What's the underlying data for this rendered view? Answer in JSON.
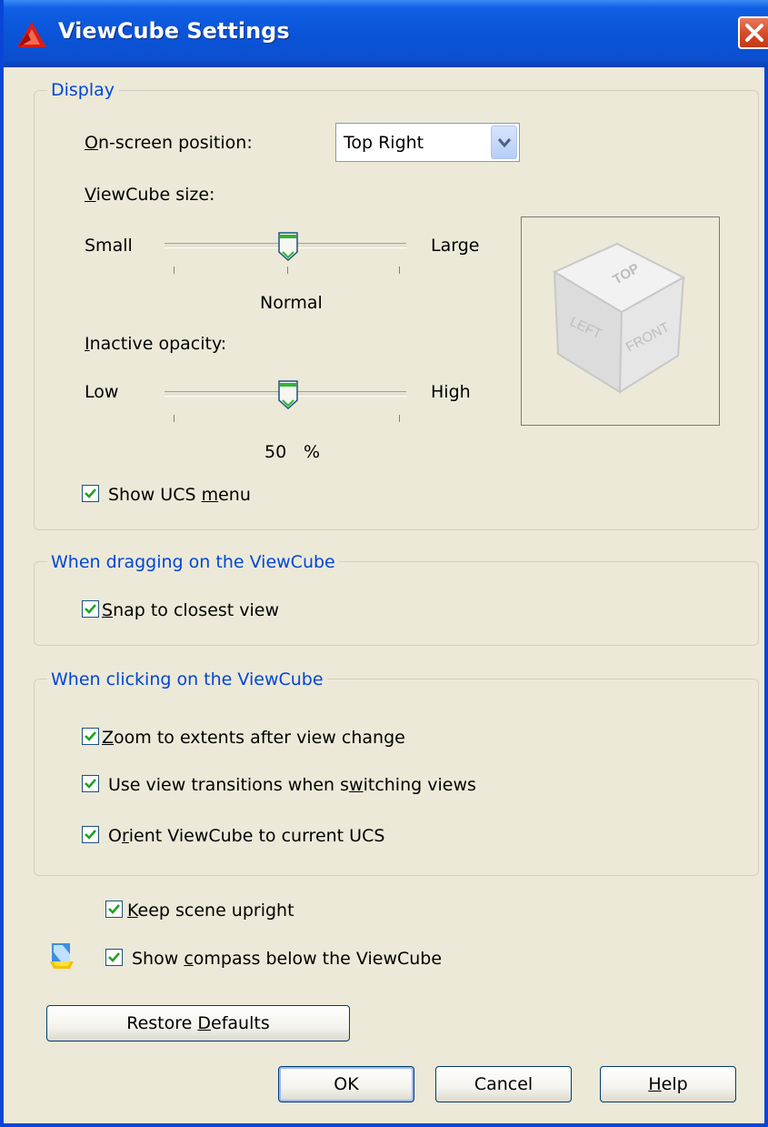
{
  "window": {
    "title": "ViewCube Settings",
    "close_icon": "close-icon"
  },
  "display": {
    "legend": "Display",
    "position_label_prefix": "O",
    "position_label_rest": "n-screen position:",
    "position_value": "Top Right",
    "size_label_prefix": "V",
    "size_label_rest": "iewCube size:",
    "size_min_label": "Small",
    "size_max_label": "Large",
    "size_value_label": "Normal",
    "size_level": 0.5,
    "opacity_label_prefix": "I",
    "opacity_label_rest": "nactive opacity:",
    "opacity_min_label": "Low",
    "opacity_max_label": "High",
    "opacity_value": "50",
    "opacity_unit": "%",
    "opacity_level": 0.5,
    "cube_faces": {
      "top": "TOP",
      "left": "LEFT",
      "front": "FRONT"
    },
    "show_ucs_menu": {
      "before": "Show UCS ",
      "underline": "m",
      "after": "enu",
      "checked": true
    }
  },
  "dragging": {
    "legend": "When dragging on the ViewCube",
    "snap": {
      "before": "",
      "underline": "S",
      "after": "nap to closest view",
      "checked": true
    }
  },
  "clicking": {
    "legend": "When clicking on the ViewCube",
    "zoom": {
      "before": "",
      "underline": "Z",
      "after": "oom to extents after view change",
      "checked": true
    },
    "transitions": {
      "before": "Use view transitions when s",
      "underline": "w",
      "after": "itching views",
      "checked": true
    },
    "orient": {
      "before": "O",
      "underline": "r",
      "after": "ient ViewCube to current UCS",
      "checked": true
    }
  },
  "keep_upright": {
    "before": "",
    "underline": "K",
    "after": "eep scene upright",
    "checked": true
  },
  "show_compass": {
    "before": "Show ",
    "underline": "c",
    "after": "ompass below the ViewCube",
    "checked": true
  },
  "buttons": {
    "restore_before": "Restore ",
    "restore_underline": "D",
    "restore_after": "efaults",
    "ok": "OK",
    "cancel": "Cancel",
    "help_underline": "H",
    "help_after": "elp"
  },
  "colors": {
    "titlebar": "#0a54d8",
    "legend": "#0046d5",
    "check": "#21a121",
    "dialog": "#ece9d8"
  }
}
